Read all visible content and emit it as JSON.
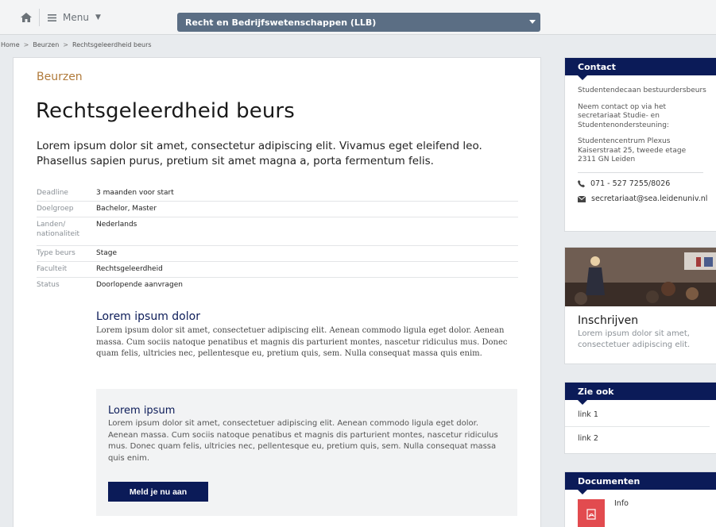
{
  "topbar": {
    "home_icon": "home-icon",
    "menu_label": "Menu",
    "menu_icon": "hamburger-icon",
    "site_select_value": "Recht en Bedrijfswetenschappen (LLB)"
  },
  "breadcrumb": {
    "items": [
      "Home",
      "Beurzen",
      "Rechtsgeleerdheid beurs"
    ],
    "separator": ">"
  },
  "main": {
    "kicker": "Beurzen",
    "title": "Rechtsgeleerdheid beurs",
    "lead": "Lorem ipsum dolor sit amet, consectetur adipiscing elit. Vivamus eget eleifend leo. Phasellus sapien purus, pretium sit amet magna a, porta fermentum felis.",
    "meta": [
      {
        "key": "Deadline",
        "value": "3 maanden voor start"
      },
      {
        "key": "Doelgroep",
        "value": "Bachelor, Master"
      },
      {
        "key": "Landen/ nationaliteit",
        "value": "Nederlands"
      },
      {
        "key": "Type beurs",
        "value": "Stage"
      },
      {
        "key": "Faculteit",
        "value": "Rechtsgeleerdheid"
      },
      {
        "key": "Status",
        "value": "Doorlopende aanvragen"
      }
    ],
    "section_title": "Lorem ipsum dolor",
    "section_text": "Lorem ipsum dolor sit amet, consectetuer adipiscing elit. Aenean commodo ligula eget dolor. Aenean massa. Cum sociis natoque penatibus et magnis dis parturient montes, nascetur ridiculus mus. Donec quam felis, ultricies nec, pellentesque eu, pretium quis, sem. Nulla consequat massa quis enim.",
    "callout": {
      "title": "Lorem ipsum",
      "text": "Lorem ipsum dolor sit amet, consectetuer adipiscing elit. Aenean commodo ligula eget dolor. Aenean massa. Cum sociis natoque penatibus et magnis dis parturient montes, nascetur ridiculus mus. Donec quam felis, ultricies nec, pellentesque eu, pretium quis, sem. Nulla consequat massa quis enim.",
      "button_label": "Meld je nu aan"
    }
  },
  "sidebar": {
    "contact": {
      "title": "Contact",
      "role": "Studentendecaan bestuurdersbeurs",
      "intro": "Neem contact op via het secretariaat Studie- en Studentenondersteuning:",
      "address": [
        "Studentencentrum Plexus",
        "Kaiserstraat 25, tweede etage",
        "2311 GN Leiden"
      ],
      "phone": "071 - 527 7255/8026",
      "email": "secretariaat@sea.leidenuniv.nl"
    },
    "promo": {
      "title": "Inschrijven",
      "text": "Lorem ipsum dolor sit amet, consectetuer adipiscing elit."
    },
    "see_also": {
      "title": "Zie ook",
      "links": [
        "link 1",
        "link 2"
      ]
    },
    "documents": {
      "title": "Documenten",
      "items": [
        {
          "label": "Info",
          "icon": "pdf-icon"
        }
      ]
    }
  },
  "colors": {
    "navy": "#0b1b58",
    "kicker": "#b07a3a",
    "select_bg": "#5b6e84",
    "pdf_red": "#e24b4f"
  }
}
